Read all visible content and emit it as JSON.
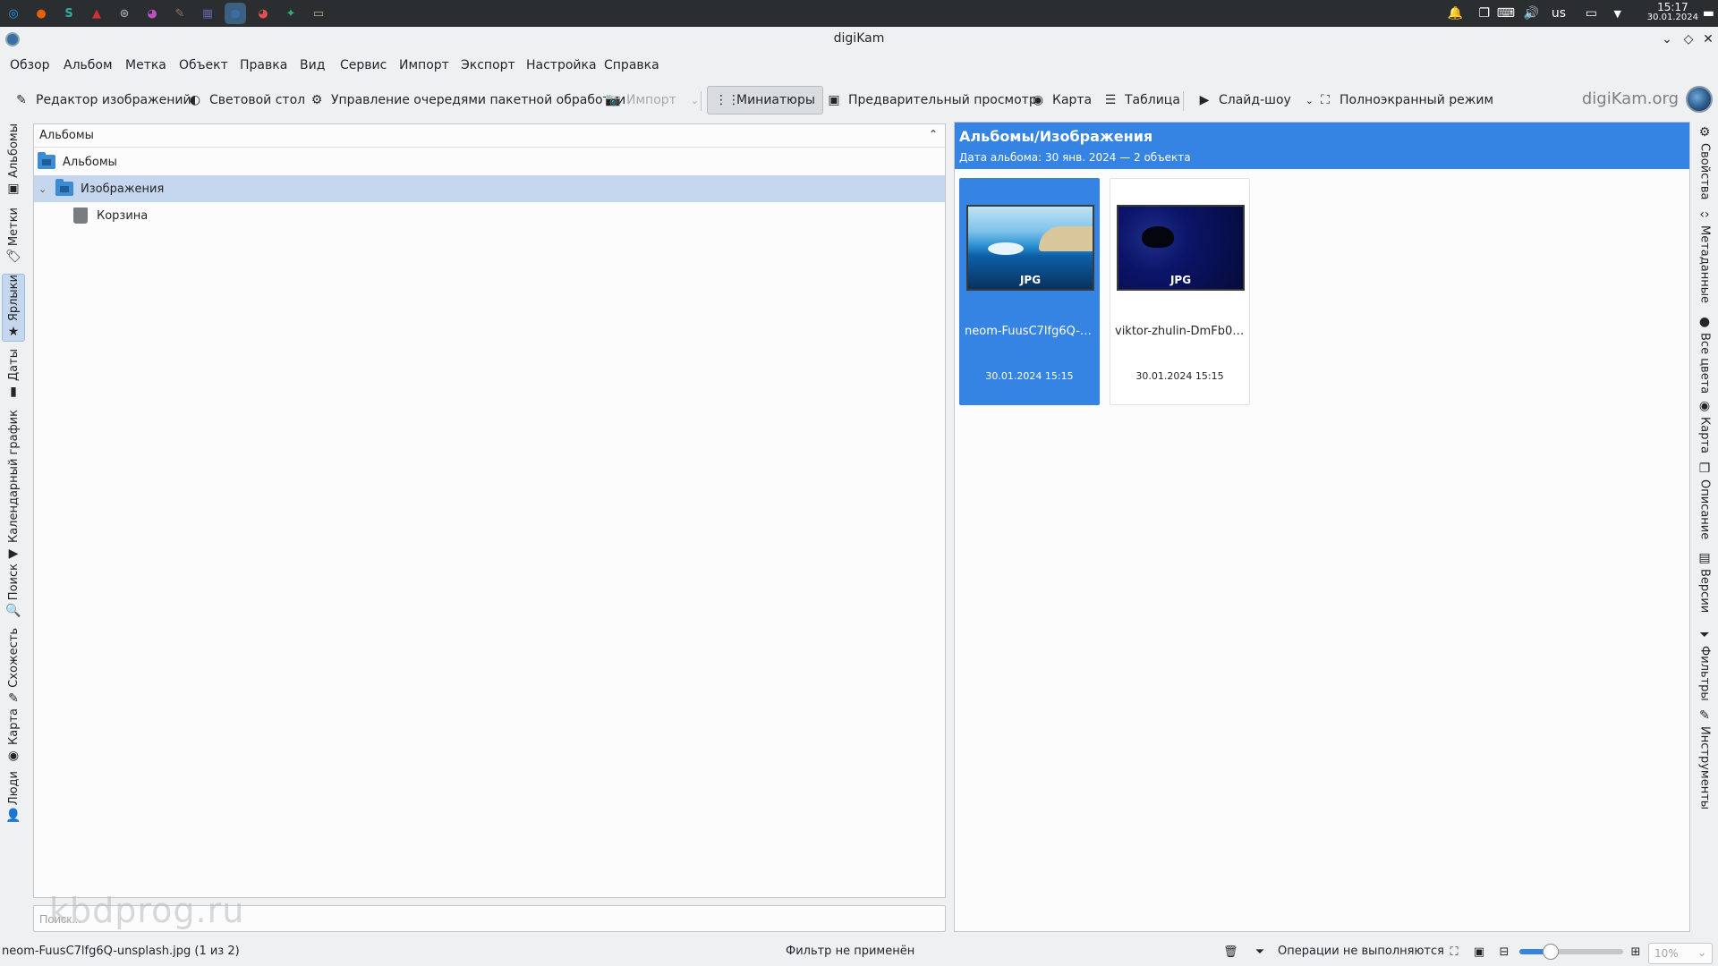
{
  "taskbar": {
    "apps": [
      {
        "name": "kde-launcher-icon",
        "glyph": "◎",
        "color": "#1d99f3"
      },
      {
        "name": "firefox-icon",
        "glyph": "●",
        "color": "#e66000"
      },
      {
        "name": "s-app-icon",
        "glyph": "S",
        "color": "#2ab0a0"
      },
      {
        "name": "red-triangle-app-icon",
        "glyph": "▲",
        "color": "#d03030"
      },
      {
        "name": "aperture-app-icon",
        "glyph": "⊛",
        "color": "#9a9a9a"
      },
      {
        "name": "color-wheel-app-icon",
        "glyph": "◕",
        "color": "#c050c0"
      },
      {
        "name": "gimp-icon",
        "glyph": "✎",
        "color": "#8a7a5a"
      },
      {
        "name": "media-app-icon",
        "glyph": "▦",
        "color": "#6060a0"
      },
      {
        "name": "digikam-taskbar-icon",
        "glyph": "●",
        "color": "#3a6ea8"
      },
      {
        "name": "color-app-icon",
        "glyph": "◕",
        "color": "#e05050"
      },
      {
        "name": "green-app-icon",
        "glyph": "✦",
        "color": "#30b070"
      },
      {
        "name": "files-app-icon",
        "glyph": "▭",
        "color": "#b0b090"
      }
    ],
    "keyboard_layout": "us",
    "time": "15:17",
    "date": "30.01.2024"
  },
  "window": {
    "title": "digiKam"
  },
  "menu": [
    "Обзор",
    "Альбом",
    "Метка",
    "Объект",
    "Правка",
    "Вид",
    "Сервис",
    "Импорт",
    "Экспорт",
    "Настройка",
    "Справка"
  ],
  "toolbar": {
    "image_editor": "Редактор изображений",
    "light_table": "Световой стол",
    "batch_queue": "Управление очередями пакетной обработки",
    "import": "Импорт",
    "thumbnails": "Миниатюры",
    "preview": "Предварительный просмотр",
    "map": "Карта",
    "table": "Таблица",
    "slideshow": "Слайд-шоу",
    "fullscreen": "Полноэкранный режим",
    "brand": "digiKam.org"
  },
  "left_tabs": [
    "Альбомы",
    "Метки",
    "Ярлыки",
    "Даты",
    "Календарный график",
    "Поиск",
    "Схожесть",
    "Карта",
    "Люди"
  ],
  "albums_panel": {
    "header": "Альбомы",
    "tree": [
      {
        "label": "Альбомы",
        "level": 0,
        "selected": false,
        "type": "folder"
      },
      {
        "label": "Изображения",
        "level": 1,
        "selected": true,
        "type": "folder"
      },
      {
        "label": "Корзина",
        "level": 2,
        "selected": false,
        "type": "trash"
      }
    ],
    "search_placeholder": "Поиск...",
    "watermark": "kbdprog.ru"
  },
  "image_view": {
    "title": "Альбомы/Изображения",
    "subtitle": "Дата альбома: 30 янв. 2024 — 2 объекта",
    "items": [
      {
        "name": "neom-FuusC7lfg6Q-u...",
        "badge": "JPG",
        "date": "30.01.2024 15:15",
        "selected": true
      },
      {
        "name": "viktor-zhulin-DmFb0K...",
        "badge": "JPG",
        "date": "30.01.2024 15:15",
        "selected": false
      }
    ]
  },
  "right_tabs": [
    "Свойства",
    "Метаданные",
    "Все цвета",
    "Карта",
    "Описание",
    "Версии",
    "Фильтры",
    "Инструменты"
  ],
  "status_bar": {
    "current_file": "neom-FuusC7lfg6Q-unsplash.jpg (1 из 2)",
    "filter": "Фильтр не применён",
    "operations": "Операции не выполняются",
    "zoom_value": 0.1,
    "zoom_text": "10%"
  }
}
